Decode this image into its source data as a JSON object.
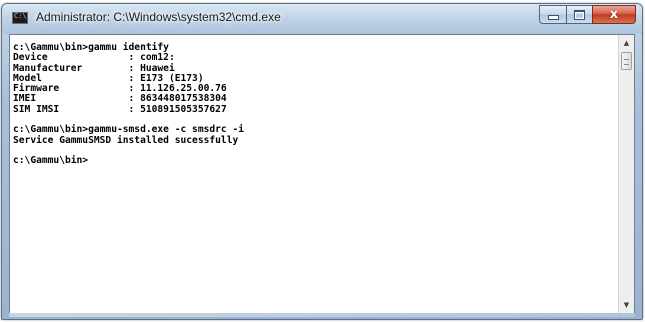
{
  "window": {
    "title": "Administrator: C:\\Windows\\system32\\cmd.exe",
    "icon": "cmd-icon",
    "controls": {
      "minimize": "minimize-icon",
      "maximize": "maximize-icon",
      "close_glyph": "x"
    }
  },
  "console": {
    "lines": [
      "c:\\Gammu\\bin>gammu identify",
      "Device              : com12:",
      "Manufacturer        : Huawei",
      "Model               : E173 (E173)",
      "Firmware            : 11.126.25.00.76",
      "IMEI                : 863448017538304",
      "SIM IMSI            : 510891505357627",
      "",
      "c:\\Gammu\\bin>gammu-smsd.exe -c smsdrc -i",
      "Service GammuSMSD installed sucessfully",
      "",
      "c:\\Gammu\\bin>"
    ]
  },
  "scrollbar": {
    "up_arrow": "▲",
    "down_arrow": "▼"
  },
  "colors": {
    "console_background": "#ffffff",
    "console_text": "#000000",
    "close_button": "#c3391f",
    "frame": "#a9c0d9"
  }
}
